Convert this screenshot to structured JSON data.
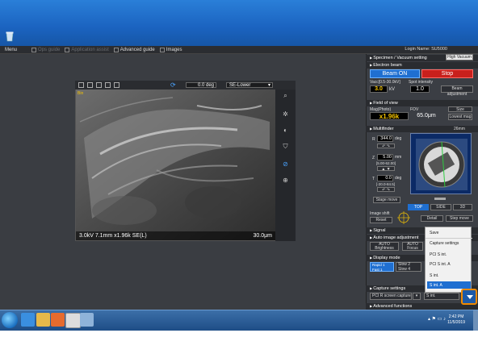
{
  "menu": {
    "menu_label": "Menu",
    "ops_guide": "Ops guide",
    "app_assist": "Application assist",
    "advanced_guide": "Advanced guide",
    "images": "Images"
  },
  "login": "Login Name: SU5000",
  "viewer": {
    "rotation": "0.0 deg",
    "detector": "SE-Lower",
    "overlay_left": "3.0kV 7.1mm x1.96k SE(L)",
    "overlay_right": "30.0μm",
    "corner_tag": "Bin"
  },
  "panel": {
    "specimen_header": "Specimen / Vacuum setting",
    "vacuum_button": "High Vacuum",
    "electron_beam_header": "Electron beam",
    "beam_on_label": "Beam ON",
    "stop_label": "Stop",
    "vacc_label": "Vacc[0.5-30.0kV]",
    "spot_label": "Spot intensity",
    "vacc_value": "3.0",
    "vacc_unit": "kV",
    "spot_value": "1.0",
    "beam_adjust": "Beam adjustment",
    "fov_header": "Field of view",
    "mag_label": "Mag(Photo)",
    "fov_label": "FOV",
    "mag_value": "x1.96k",
    "fov_value": "65.0μm",
    "size_select": "Size",
    "lowest_mag": "Lowest mag",
    "multifinder_header": "Multifinder",
    "multifinder_size": "26mm",
    "r_label": "R",
    "r_value": "344.0",
    "r_unit": "deg",
    "z_label": "Z",
    "z_value": "5.00",
    "z_unit": "mm",
    "z_range": "[5.00-62.00]",
    "t_label": "T",
    "t_value": "0.0",
    "t_unit": "deg",
    "t_range": "[-20.0-84.5]",
    "stage_move": "Stage move",
    "view_top": "TOP",
    "view_side": "SIDE",
    "view_3d": "3D",
    "image_shift_label": "Image shift",
    "reset_button": "Reset",
    "detail_button": "Detail",
    "step_move_button": "Step move",
    "signal_header": "Signal",
    "auto_header": "Auto image adjustment",
    "auto_brightness": "AUTO Brightness",
    "auto_focus": "AUTO Focus",
    "display_header": "Display mode",
    "rapid_label": "Rapid 1",
    "fast_label": "Fast 1",
    "slow_label": "Slow 2",
    "slow4_label": "Slow 4",
    "capture_header": "Capture settings",
    "capture_mode": "PCI R screen capture",
    "capture_value": "S int.",
    "advanced_header": "Advanced functions"
  },
  "capture_menu": {
    "items": [
      "Save",
      "Capture settings",
      "PCI S int.",
      "PCI S int. A",
      "S int.",
      "S int. A"
    ]
  },
  "taskbar": {
    "time": "2:42 PM",
    "date": "11/5/2019"
  }
}
